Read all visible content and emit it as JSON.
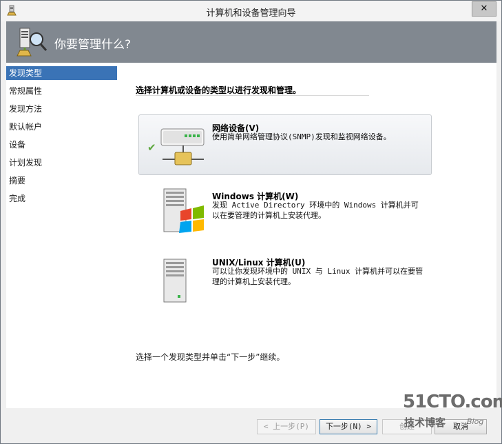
{
  "window": {
    "title": "计算机和设备管理向导",
    "close_label": "✕"
  },
  "header": {
    "title": "你要管理什么?",
    "icon": "discovery-wizard-icon"
  },
  "nav": {
    "items": [
      {
        "label": "发现类型",
        "active": true
      },
      {
        "label": "常规属性",
        "active": false
      },
      {
        "label": "发现方法",
        "active": false
      },
      {
        "label": "默认帐户",
        "active": false
      },
      {
        "label": "设备",
        "active": false
      },
      {
        "label": "计划发现",
        "active": false
      },
      {
        "label": "摘要",
        "active": false
      },
      {
        "label": "完成",
        "active": false
      }
    ]
  },
  "content": {
    "heading": "选择计算机或设备的类型以进行发现和管理。",
    "options": [
      {
        "title": "网络设备(V)",
        "desc": "使用简单网络管理协议(SNMP)发现和监视网络设备。",
        "icon": "network-device-icon",
        "selected": true
      },
      {
        "title": "Windows 计算机(W)",
        "desc": "发现 Active Directory 环境中的 Windows 计算机并可以在要管理的计算机上安装代理。",
        "icon": "windows-computer-icon",
        "selected": false
      },
      {
        "title": "UNIX/Linux 计算机(U)",
        "desc": "可以让你发现环境中的 UNIX 与 Linux 计算机并可以在要管理的计算机上安装代理。",
        "icon": "unix-linux-computer-icon",
        "selected": false
      }
    ],
    "instruction": "选择一个发现类型并单击“下一步”继续。"
  },
  "footer": {
    "back_label": "< 上一步(P)",
    "next_label": "下一步(N) >",
    "create_label": "创建",
    "cancel_label": "取消"
  },
  "watermark": {
    "site": "51CTO.com",
    "tagline": "技术博客",
    "blog": "Blog"
  },
  "colors": {
    "header_bg": "#818890",
    "nav_active": "#3a73b6",
    "check": "#5aa63a"
  }
}
